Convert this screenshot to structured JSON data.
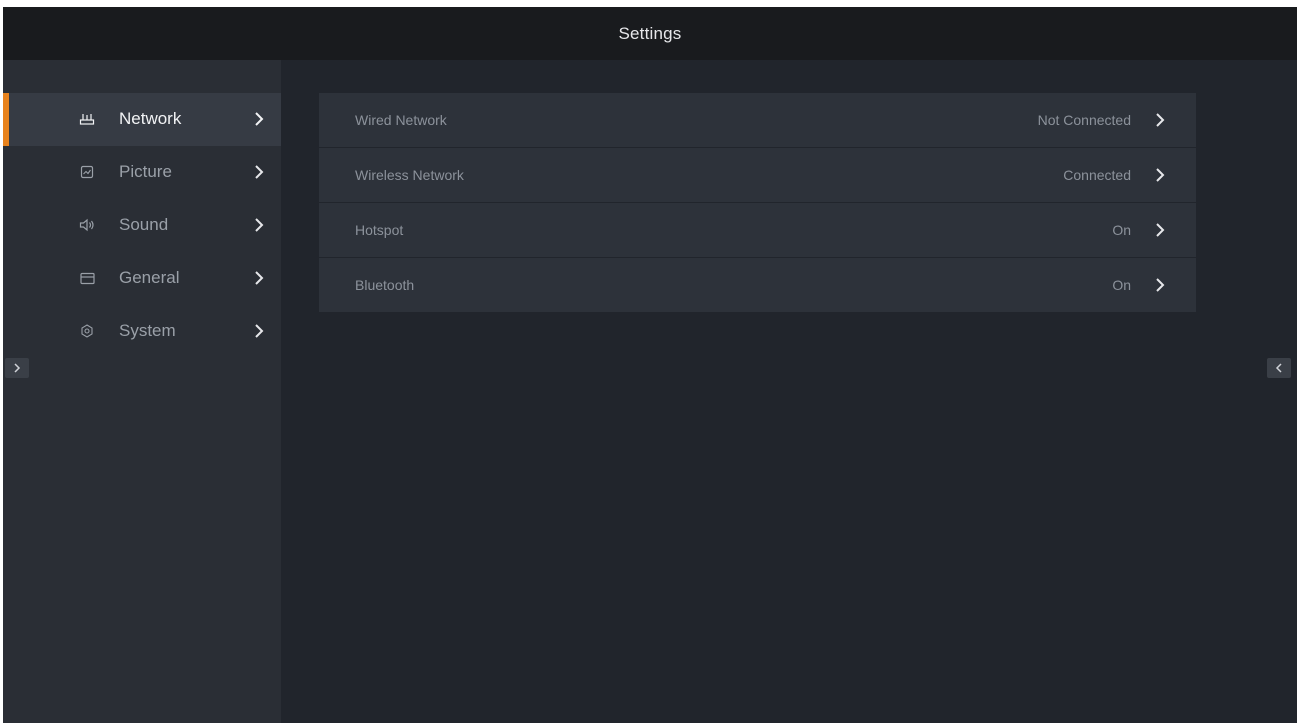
{
  "header": {
    "title": "Settings"
  },
  "sidebar": {
    "items": [
      {
        "label": "Network",
        "icon": "router-icon",
        "active": true
      },
      {
        "label": "Picture",
        "icon": "picture-icon",
        "active": false
      },
      {
        "label": "Sound",
        "icon": "speaker-icon",
        "active": false
      },
      {
        "label": "General",
        "icon": "window-icon",
        "active": false
      },
      {
        "label": "System",
        "icon": "gear-icon",
        "active": false
      }
    ]
  },
  "main": {
    "rows": [
      {
        "label": "Wired Network",
        "value": "Not Connected"
      },
      {
        "label": "Wireless Network",
        "value": "Connected"
      },
      {
        "label": "Hotspot",
        "value": "On"
      },
      {
        "label": "Bluetooth",
        "value": "On"
      }
    ]
  },
  "colors": {
    "accent": "#e8821c",
    "background": "#21252c",
    "sidebar": "#2a2e35",
    "titlebar": "#191b1e",
    "row": "#2d323a"
  }
}
